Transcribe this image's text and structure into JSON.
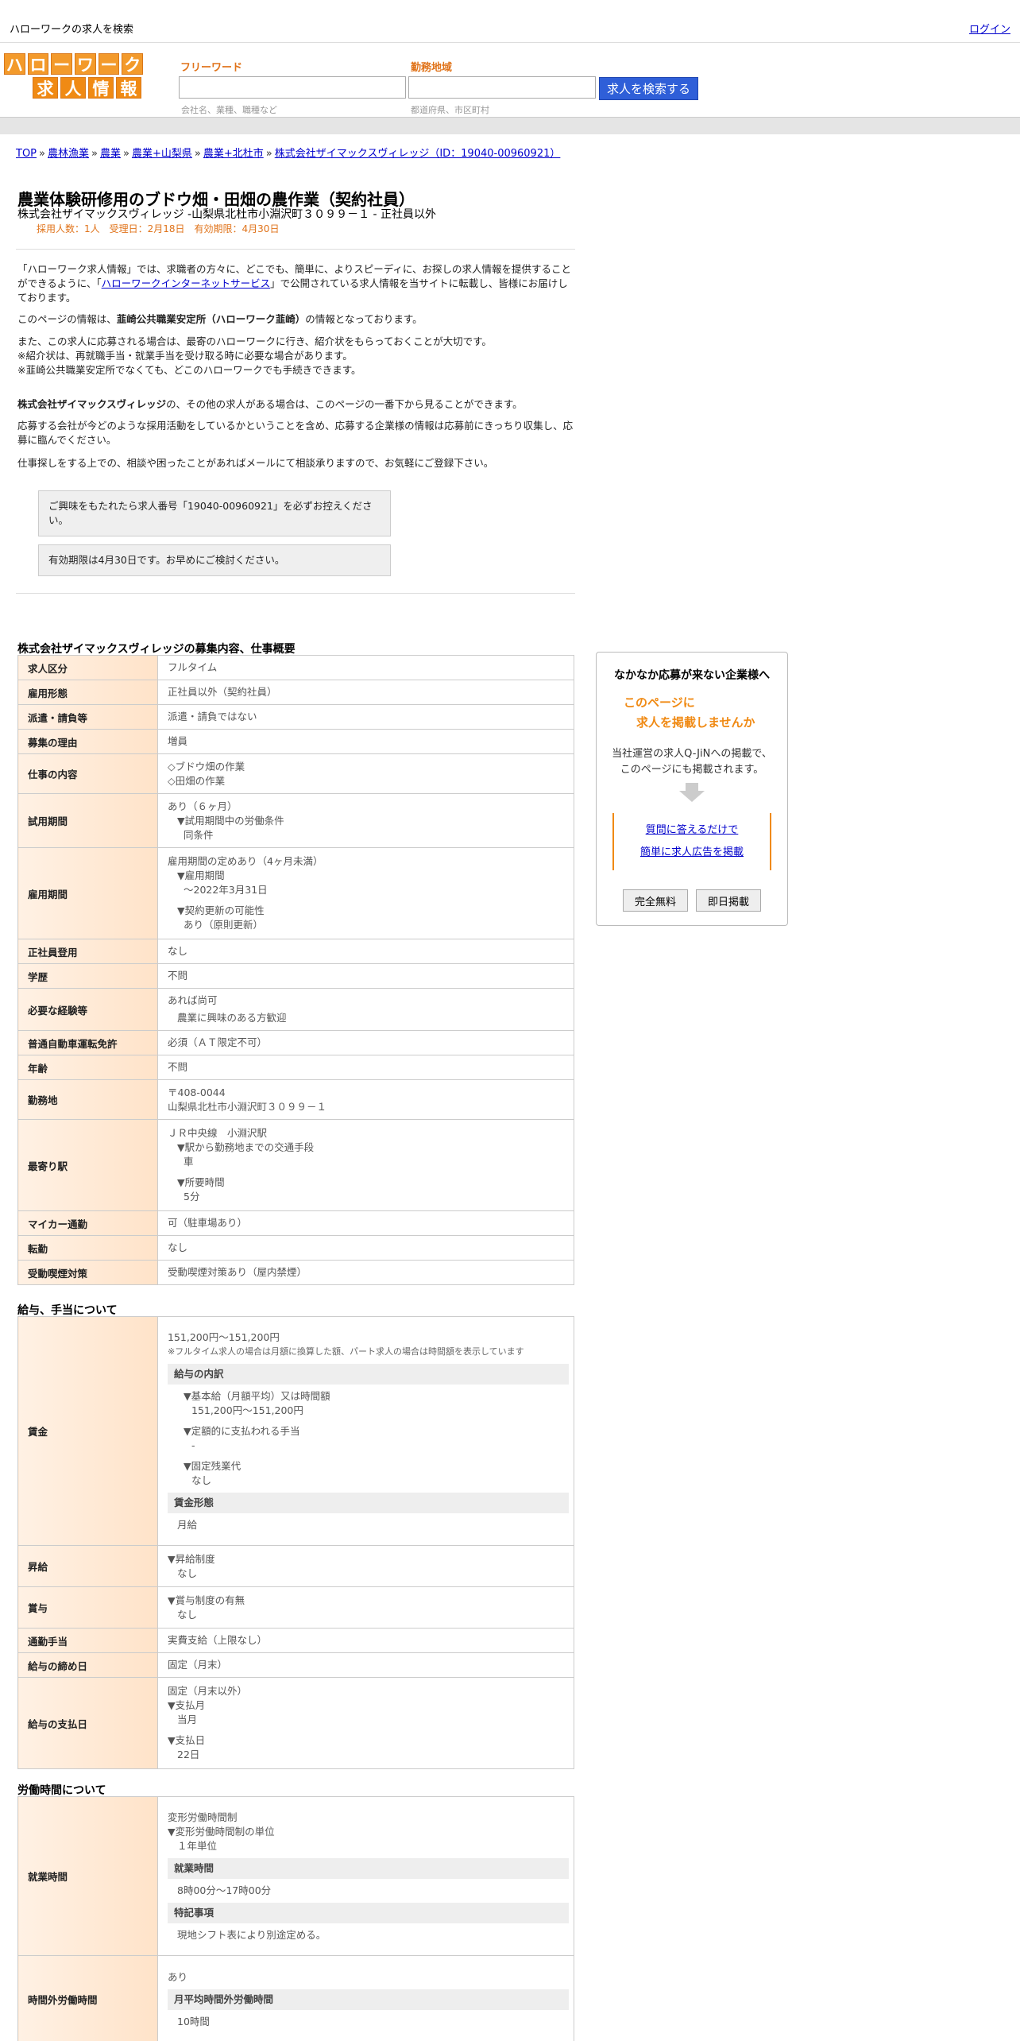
{
  "topbar": {
    "site_title": "ハローワークの求人を検索",
    "login": "ログイン"
  },
  "logo": {
    "row1": [
      "ハ",
      "ロ",
      "ー",
      "ワ",
      "ー",
      "ク"
    ],
    "row2": [
      "求",
      "人",
      "情",
      "報"
    ]
  },
  "search": {
    "freeword_label": "フリーワード",
    "freeword_hint": "会社名、業種、職種など",
    "area_label": "勤務地域",
    "area_hint": "都道府県、市区町村",
    "button": "求人を検索する"
  },
  "breadcrumb": [
    "TOP",
    "農林漁業",
    "農業",
    "農業+山梨県",
    "農業+北杜市",
    "株式会社ザイマックスヴィレッジ（ID：19040-00960921）"
  ],
  "breadcrumb_sep": "»",
  "job": {
    "title": "農業体験研修用のブドウ畑・田畑の農作業（契約社員）",
    "subtitle": "株式会社ザイマックスヴィレッジ -山梨県北杜市小淵沢町３０９９－１ - 正社員以外",
    "meta": "採用人数：1人　受理日：2月18日　有効期限：4月30日"
  },
  "intro": {
    "p1a": "「ハローワーク求人情報」では、求職者の方々に、どこでも、簡単に、よりスピーディに、お探しの求人情報を提供することができるように、「",
    "p1link": "ハローワークインターネットサービス",
    "p1b": "」で公開されている求人情報を当サイトに転載し、皆様にお届けしております。",
    "p2a": "このページの情報は、",
    "p2b": "韮崎公共職業安定所（ハローワーク韮崎）",
    "p2c": "の情報となっております。",
    "p3": "また、この求人に応募される場合は、最寄のハローワークに行き、紹介状をもらっておくことが大切です。",
    "p4": "※紹介状は、再就職手当・就業手当を受け取る時に必要な場合があります。",
    "p5": "※韮崎公共職業安定所でなくても、どこのハローワークでも手続きできます。",
    "p6a": "株式会社ザイマックスヴィレッジ",
    "p6b": "の、その他の求人がある場合は、このページの一番下から見ることができます。",
    "p7": "応募する会社が今どのような採用活動をしているかということを含め、応募する企業様の情報は応募前にきっちり収集し、応募に臨んでください。",
    "p8": "仕事探しをする上での、相談や困ったことがあればメールにて相談承りますので、お気軽にご登録下さい。"
  },
  "notices": {
    "n1": "ご興味をもたれたら求人番号「19040-00960921」を必ずお控えください。",
    "n2": "有効期限は4月30日です。お早めにご検討ください。"
  },
  "sections": {
    "s1": "株式会社ザイマックスヴィレッジの募集内容、仕事概要",
    "s2": "給与、手当について",
    "s3": "労働時間について"
  },
  "t1": {
    "r1k": "求人区分",
    "r1v": "フルタイム",
    "r2k": "雇用形態",
    "r2v": "正社員以外（契約社員）",
    "r3k": "派遣・請負等",
    "r3v": "派遣・請負ではない",
    "r4k": "募集の理由",
    "r4v": "増員",
    "r5k": "仕事の内容",
    "r5v1": "◇ブドウ畑の作業",
    "r5v2": "◇田畑の作業",
    "r6k": "試用期間",
    "r6v1": "あり（６ヶ月）",
    "r6v2": "▼試用期間中の労働条件",
    "r6v3": "同条件",
    "r7k": "雇用期間",
    "r7v1": "雇用期間の定めあり（4ヶ月未満）",
    "r7v2": "▼雇用期間",
    "r7v3": "〜2022年3月31日",
    "r7v4": "▼契約更新の可能性",
    "r7v5": "あり（原則更新）",
    "r8k": "正社員登用",
    "r8v": "なし",
    "r9k": "学歴",
    "r9v": "不問",
    "r10k": "必要な経験等",
    "r10v1": "あれば尚可",
    "r10v2": "農業に興味のある方歓迎",
    "r11k": "普通自動車運転免許",
    "r11v": "必須（ＡＴ限定不可）",
    "r12k": "年齢",
    "r12v": "不問",
    "r13k": "勤務地",
    "r13v1": "〒408-0044",
    "r13v2": "山梨県北杜市小淵沢町３０９９－１",
    "r14k": "最寄り駅",
    "r14v1": "ＪＲ中央線　小淵沢駅",
    "r14v2": "▼駅から勤務地までの交通手段",
    "r14v3": "車",
    "r14v4": "▼所要時間",
    "r14v5": "5分",
    "r15k": "マイカー通勤",
    "r15v": "可（駐車場あり）",
    "r16k": "転勤",
    "r16v": "なし",
    "r17k": "受動喫煙対策",
    "r17v": "受動喫煙対策あり（屋内禁煙）"
  },
  "t2": {
    "r1k": "賃金",
    "r1v1": "151,200円〜151,200円",
    "r1note": "※フルタイム求人の場合は月額に換算した額、パート求人の場合は時間額を表示しています",
    "r1h1": "給与の内訳",
    "r1v2": "▼基本給（月額平均）又は時間額",
    "r1v3": "151,200円〜151,200円",
    "r1v4": "▼定額的に支払われる手当",
    "r1v5": "-",
    "r1v6": "▼固定残業代",
    "r1v7": "なし",
    "r1h2": "賃金形態",
    "r1v8": "月給",
    "r2k": "昇給",
    "r2v1": "▼昇給制度",
    "r2v2": "なし",
    "r3k": "賞与",
    "r3v1": "▼賞与制度の有無",
    "r3v2": "なし",
    "r4k": "通勤手当",
    "r4v": "実費支給（上限なし）",
    "r5k": "給与の締め日",
    "r5v": "固定（月末）",
    "r6k": "給与の支払日",
    "r6v1": "固定（月末以外）",
    "r6v2": "▼支払月",
    "r6v3": "当月",
    "r6v4": "▼支払日",
    "r6v5": "22日"
  },
  "t3": {
    "r1k": "就業時間",
    "r1v1": "変形労働時間制",
    "r1v2": "▼変形労働時間制の単位",
    "r1v3": "１年単位",
    "r1h1": "就業時間",
    "r1v4": "8時00分〜17時00分",
    "r1h2": "特記事項",
    "r1v5": "現地シフト表により別途定める。",
    "r2k": "時間外労働時間",
    "r2v1": "あり",
    "r2h1": "月平均時間外労働時間",
    "r2v2": "10時間"
  },
  "sidebox": {
    "title": "なかなか応募が来ない企業様へ",
    "hl1": "このページに",
    "hl2": "求人を掲載しませんか",
    "text1": "当社運営の求人Q-JiNへの掲載で、",
    "text2": "このページにも掲載されます。",
    "link1": "質問に答えるだけで",
    "link2": "簡単に求人広告を掲載",
    "btn1": "完全無料",
    "btn2": "即日掲載"
  }
}
